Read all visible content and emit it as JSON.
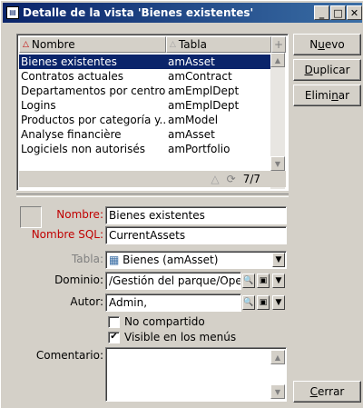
{
  "window": {
    "title": "Detalle de la vista 'Bienes existentes'",
    "minimize": "_",
    "restore": "□",
    "close": "✕"
  },
  "list": {
    "columns": [
      "Nombre",
      "Tabla"
    ],
    "rows": [
      {
        "nombre": "Bienes existentes",
        "tabla": "amAsset"
      },
      {
        "nombre": "Contratos actuales",
        "tabla": "amContract"
      },
      {
        "nombre": "Departamentos por centro...",
        "tabla": "amEmplDept"
      },
      {
        "nombre": "Logins",
        "tabla": "amEmplDept"
      },
      {
        "nombre": "Productos por categoría y...",
        "tabla": "amModel"
      },
      {
        "nombre": "Analyse financière",
        "tabla": "amAsset"
      },
      {
        "nombre": "Logiciels non autorisés",
        "tabla": "amPortfolio"
      }
    ],
    "selected_index": 0,
    "counter": "7/7"
  },
  "buttons": {
    "nuevo": {
      "pre": "N",
      "ul": "u",
      "post": "evo"
    },
    "duplicar": {
      "pre": "",
      "ul": "D",
      "post": "uplicar"
    },
    "eliminar": {
      "pre": "Elimi",
      "ul": "n",
      "post": "ar"
    },
    "cerrar": {
      "pre": "",
      "ul": "C",
      "post": "errar"
    }
  },
  "form": {
    "nombre_label": "Nombre:",
    "nombre_value": "Bienes existentes",
    "nombre_sql_label": "Nombre SQL:",
    "nombre_sql_value": "CurrentAssets",
    "tabla_label": "Tabla:",
    "tabla_value": "Bienes (amAsset)",
    "dominio_label": "Dominio:",
    "dominio_value": "/Gestión del parque/Oper",
    "autor_label": "Autor:",
    "autor_value": "Admin,",
    "no_compartido_label": "No compartido",
    "no_compartido_checked": false,
    "visible_label": "Visible en los menús",
    "visible_checked": true,
    "comentario_label": "Comentario:",
    "comentario_value": ""
  }
}
